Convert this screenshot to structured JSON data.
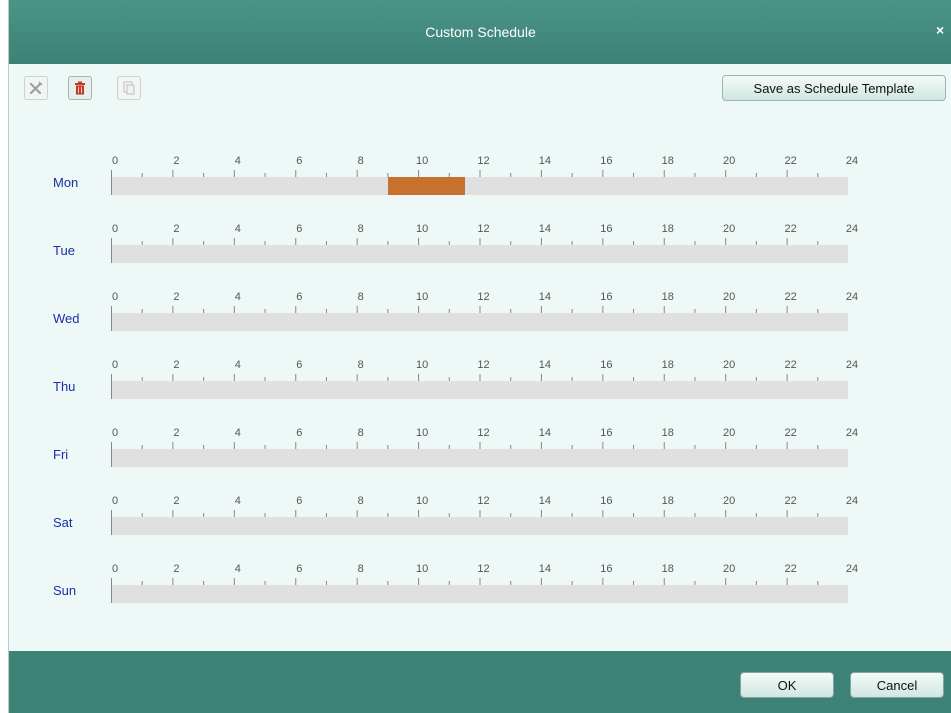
{
  "title": "Custom Schedule",
  "toolbar": {
    "delete_icon": "x-icon",
    "trash_icon": "trash-icon",
    "copy_icon": "copy-icon",
    "save_template_label": "Save as Schedule Template"
  },
  "hour_labels": [
    "0",
    "2",
    "4",
    "6",
    "8",
    "10",
    "12",
    "14",
    "16",
    "18",
    "20",
    "22",
    "24"
  ],
  "days": [
    {
      "label": "Mon",
      "segments": [
        {
          "start": 9.0,
          "end": 11.5
        }
      ]
    },
    {
      "label": "Tue",
      "segments": []
    },
    {
      "label": "Wed",
      "segments": []
    },
    {
      "label": "Thu",
      "segments": []
    },
    {
      "label": "Fri",
      "segments": []
    },
    {
      "label": "Sat",
      "segments": []
    },
    {
      "label": "Sun",
      "segments": []
    }
  ],
  "footer": {
    "ok_label": "OK",
    "cancel_label": "Cancel"
  },
  "colors": {
    "accent": "#3d8276",
    "segment": "#c8702d",
    "day_label": "#1a2ea8"
  }
}
